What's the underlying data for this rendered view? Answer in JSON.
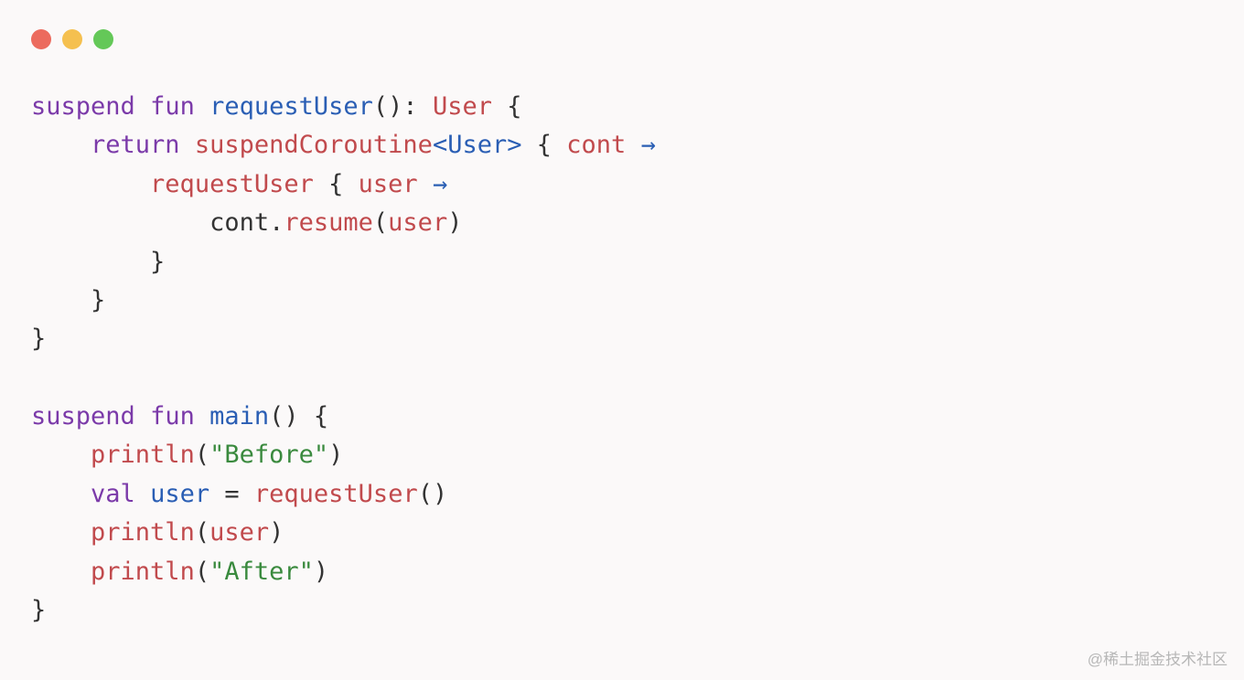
{
  "code": {
    "tokens": [
      {
        "c": "kw",
        "t": "suspend"
      },
      {
        "c": "sp",
        "t": " "
      },
      {
        "c": "kw",
        "t": "fun"
      },
      {
        "c": "sp",
        "t": " "
      },
      {
        "c": "fn",
        "t": "requestUser"
      },
      {
        "c": "punct",
        "t": "(): "
      },
      {
        "c": "type",
        "t": "User"
      },
      {
        "c": "punct",
        "t": " {"
      },
      {
        "c": "nl"
      },
      {
        "c": "sp",
        "t": "    "
      },
      {
        "c": "kw",
        "t": "return"
      },
      {
        "c": "sp",
        "t": " "
      },
      {
        "c": "id",
        "t": "suspendCoroutine"
      },
      {
        "c": "angle",
        "t": "<"
      },
      {
        "c": "fn",
        "t": "User"
      },
      {
        "c": "angle",
        "t": ">"
      },
      {
        "c": "punct",
        "t": " { "
      },
      {
        "c": "id",
        "t": "cont"
      },
      {
        "c": "sp",
        "t": " "
      },
      {
        "c": "arrow",
        "t": "→"
      },
      {
        "c": "nl"
      },
      {
        "c": "sp",
        "t": "        "
      },
      {
        "c": "id",
        "t": "requestUser"
      },
      {
        "c": "punct",
        "t": " { "
      },
      {
        "c": "id",
        "t": "user"
      },
      {
        "c": "sp",
        "t": " "
      },
      {
        "c": "arrow",
        "t": "→"
      },
      {
        "c": "nl"
      },
      {
        "c": "sp",
        "t": "            "
      },
      {
        "c": "punct",
        "t": "cont."
      },
      {
        "c": "id",
        "t": "resume"
      },
      {
        "c": "punct",
        "t": "("
      },
      {
        "c": "id",
        "t": "user"
      },
      {
        "c": "punct",
        "t": ")"
      },
      {
        "c": "nl"
      },
      {
        "c": "sp",
        "t": "        "
      },
      {
        "c": "punct",
        "t": "}"
      },
      {
        "c": "nl"
      },
      {
        "c": "sp",
        "t": "    "
      },
      {
        "c": "punct",
        "t": "}"
      },
      {
        "c": "nl"
      },
      {
        "c": "punct",
        "t": "}"
      },
      {
        "c": "nl"
      },
      {
        "c": "nl"
      },
      {
        "c": "kw",
        "t": "suspend"
      },
      {
        "c": "sp",
        "t": " "
      },
      {
        "c": "kw",
        "t": "fun"
      },
      {
        "c": "sp",
        "t": " "
      },
      {
        "c": "fn",
        "t": "main"
      },
      {
        "c": "punct",
        "t": "() {"
      },
      {
        "c": "nl"
      },
      {
        "c": "sp",
        "t": "    "
      },
      {
        "c": "id",
        "t": "println"
      },
      {
        "c": "punct",
        "t": "("
      },
      {
        "c": "str",
        "t": "\"Before\""
      },
      {
        "c": "punct",
        "t": ")"
      },
      {
        "c": "nl"
      },
      {
        "c": "sp",
        "t": "    "
      },
      {
        "c": "kw",
        "t": "val"
      },
      {
        "c": "sp",
        "t": " "
      },
      {
        "c": "fn",
        "t": "user"
      },
      {
        "c": "punct",
        "t": " = "
      },
      {
        "c": "id",
        "t": "requestUser"
      },
      {
        "c": "punct",
        "t": "()"
      },
      {
        "c": "nl"
      },
      {
        "c": "sp",
        "t": "    "
      },
      {
        "c": "id",
        "t": "println"
      },
      {
        "c": "punct",
        "t": "("
      },
      {
        "c": "id",
        "t": "user"
      },
      {
        "c": "punct",
        "t": ")"
      },
      {
        "c": "nl"
      },
      {
        "c": "sp",
        "t": "    "
      },
      {
        "c": "id",
        "t": "println"
      },
      {
        "c": "punct",
        "t": "("
      },
      {
        "c": "str",
        "t": "\"After\""
      },
      {
        "c": "punct",
        "t": ")"
      },
      {
        "c": "nl"
      },
      {
        "c": "punct",
        "t": "}"
      }
    ]
  },
  "watermark": "@稀土掘金技术社区"
}
